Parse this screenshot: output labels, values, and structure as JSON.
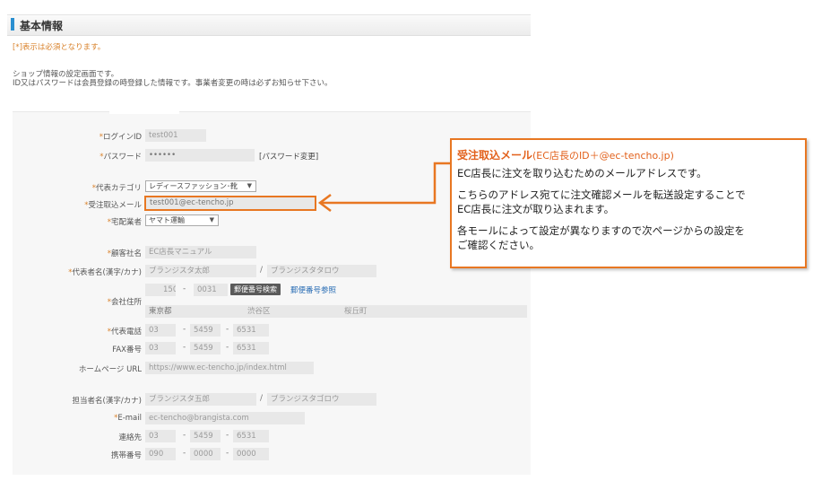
{
  "section": {
    "title": "基本情報"
  },
  "notice": {
    "required": "[*]表示は必須となります。",
    "line1": "ショップ情報の設定画面です。",
    "line2": "ID又はパスワードは会員登録の時登録した情報です。事業者変更の時は必ずお知らせ下さい。"
  },
  "form": {
    "login_id": {
      "label": "ログインID",
      "value": "test001"
    },
    "password": {
      "label": "パスワード",
      "value": "••••••",
      "change_label": "[パスワード変更]"
    },
    "category": {
      "label": "代表カテゴリ",
      "value": "レディースファッション･靴"
    },
    "order_mail": {
      "label": "受注取込メール",
      "value": "test001@ec-tencho.jp"
    },
    "carrier": {
      "label": "宅配業者",
      "value": "ヤマト運輸"
    },
    "company": {
      "label": "顧客社名",
      "value": "EC店長マニュアル"
    },
    "rep_name": {
      "label": "代表者名(漢字/カナ)",
      "kanji": "ブランジスタ太郎",
      "sep": "/",
      "kana": "ブランジスタタロウ"
    },
    "address": {
      "label": "会社住所",
      "zip1": "150",
      "zip_dash": "-",
      "zip2": "0031",
      "zip_search": "郵便番号検索",
      "zip_ref": "郵便番号参照",
      "pref": "東京都",
      "city": "渋谷区",
      "town": "桜丘町"
    },
    "phone": {
      "label": "代表電話",
      "p1": "03",
      "p2": "5459",
      "p3": "6531"
    },
    "fax": {
      "label": "FAX番号",
      "p1": "03",
      "p2": "5459",
      "p3": "6531"
    },
    "homepage": {
      "label": "ホームページ URL",
      "value": "https://www.ec-tencho.jp/index.html"
    },
    "staff_name": {
      "label": "担当者名(漢字/カナ)",
      "kanji": "ブランジスタ五郎",
      "sep": "/",
      "kana": "ブランジスタゴロウ"
    },
    "email": {
      "label": "E-mail",
      "value": "ec-tencho@brangista.com"
    },
    "contact": {
      "label": "連絡先",
      "p1": "03",
      "p2": "5459",
      "p3": "6531"
    },
    "mobile": {
      "label": "携帯番号",
      "p1": "090",
      "p2": "0000",
      "p3": "0000"
    },
    "dash": "-",
    "star": "*"
  },
  "callout": {
    "title": "受注取込メール",
    "subtitle": "(EC店長のID＋@ec-tencho.jp)",
    "line1": "EC店長に注文を取り込むためのメールアドレスです。",
    "line2": "こちらのアドレス宛てに注文確認メールを転送設定することで",
    "line3": "EC店長に注文が取り込まれます。",
    "line4": "各モールによって設定が異なりますので次ページからの設定を",
    "line5": "ご確認ください。"
  },
  "colors": {
    "accent": "#e87722",
    "heading_bar": "#2a8fd0",
    "required": "#d9822b",
    "link": "#2c6fb5"
  }
}
